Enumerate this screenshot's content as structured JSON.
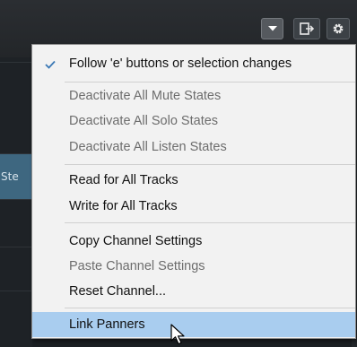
{
  "toolbar": {
    "buttons": [
      {
        "icon": "chevron-down-icon"
      },
      {
        "icon": "export-icon"
      },
      {
        "icon": "gear-icon"
      }
    ]
  },
  "background": {
    "track_label": "Ste"
  },
  "menu": {
    "items": [
      {
        "label": "Follow 'e' buttons or selection changes",
        "checked": true,
        "enabled": true
      },
      {
        "label": "Deactivate All Mute States",
        "enabled": false
      },
      {
        "label": "Deactivate All Solo States",
        "enabled": false
      },
      {
        "label": "Deactivate All Listen States",
        "enabled": false
      },
      {
        "label": "Read for All Tracks",
        "enabled": true
      },
      {
        "label": "Write for All Tracks",
        "enabled": true
      },
      {
        "label": "Copy Channel Settings",
        "enabled": true
      },
      {
        "label": "Paste Channel Settings",
        "enabled": false
      },
      {
        "label": "Reset Channel...",
        "enabled": true
      },
      {
        "label": "Link Panners",
        "enabled": true,
        "highlighted": true
      }
    ]
  },
  "colors": {
    "highlight": "#a9cdef",
    "checkmark": "#3a78b5",
    "disabled_text": "#6d6d6d",
    "selected_track": "#3e6780"
  }
}
